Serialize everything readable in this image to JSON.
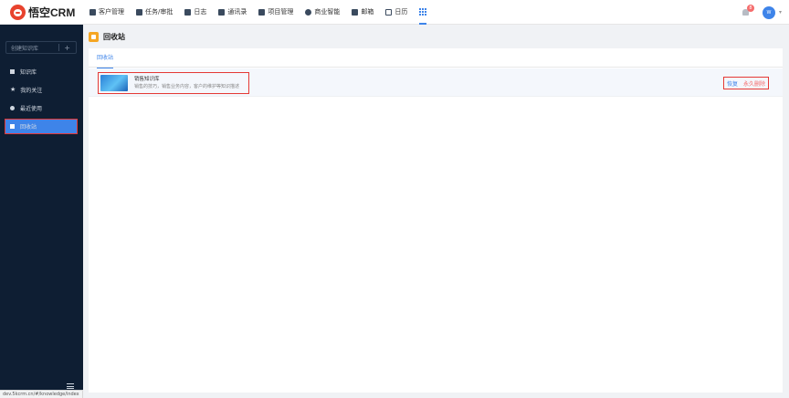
{
  "app": {
    "logo_text": "悟空CRM"
  },
  "topnav": {
    "items": [
      {
        "label": "客户管理"
      },
      {
        "label": "任务/审批"
      },
      {
        "label": "日志"
      },
      {
        "label": "通讯录"
      },
      {
        "label": "项目管理"
      },
      {
        "label": "商业智能"
      },
      {
        "label": "邮箱"
      },
      {
        "label": "日历"
      }
    ],
    "more_icon": "apps-grid-icon",
    "notification_count": "8",
    "avatar_text": "W"
  },
  "sidebar": {
    "create_label": "创建知识库",
    "items": [
      {
        "label": "知识库",
        "icon": "book-icon"
      },
      {
        "label": "我的关注",
        "icon": "star-icon"
      },
      {
        "label": "最近使用",
        "icon": "clock-icon"
      },
      {
        "label": "回收站",
        "icon": "trash-icon",
        "active": true
      }
    ]
  },
  "page": {
    "title": "回收站"
  },
  "tabs": [
    {
      "label": "回收站",
      "active": true
    }
  ],
  "rows": [
    {
      "title": "销售知识库",
      "description": "销售的技巧，销售业务内容，客户的维护等知识描述",
      "restore_label": "恢复",
      "delete_label": "永久删除"
    }
  ],
  "statusbar": {
    "url": "dev.5kcrm.cn/#/knowledge/index"
  },
  "colors": {
    "accent": "#3e84e9",
    "sidebar_bg": "#0e1e33",
    "danger": "#f56c6c",
    "highlight_border": "#e53935"
  }
}
